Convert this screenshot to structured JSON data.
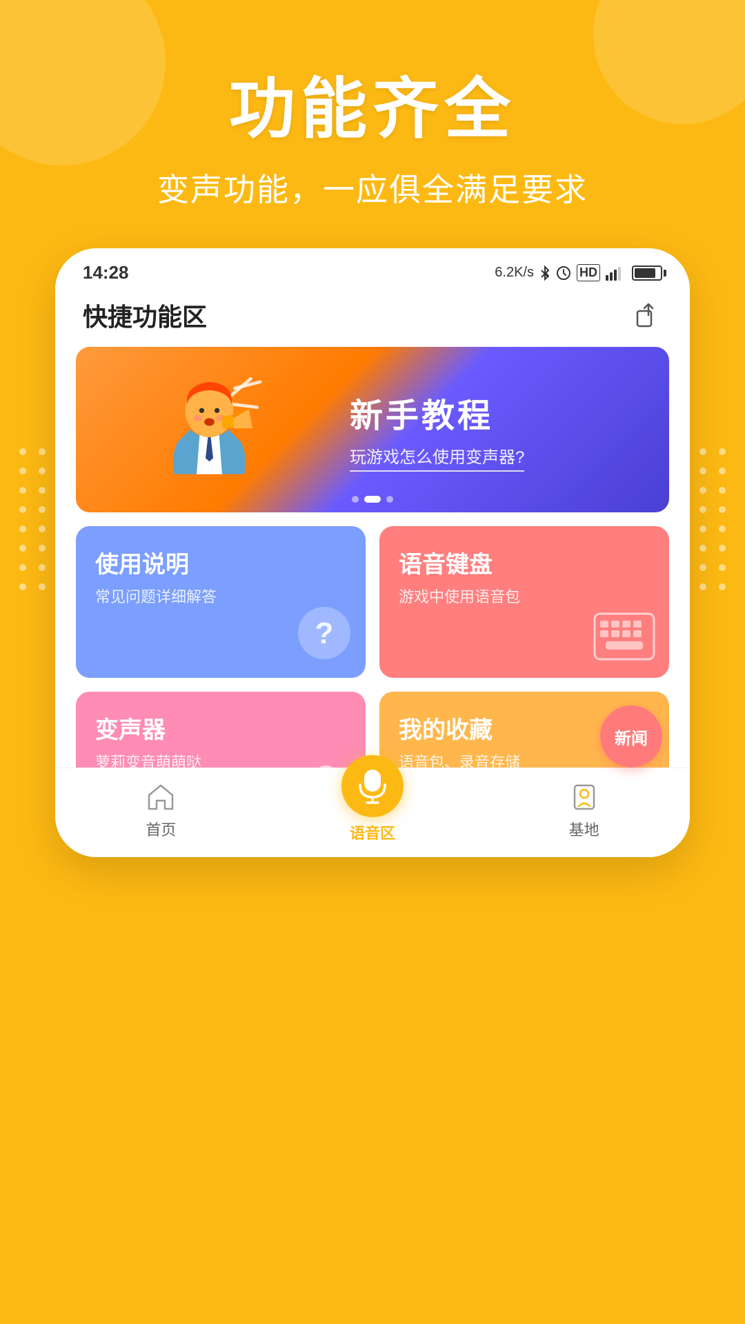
{
  "background_color": "#FDB913",
  "header": {
    "main_title": "功能齐全",
    "sub_title": "变声功能，一应俱全满足要求"
  },
  "status_bar": {
    "time": "14:28",
    "network_speed": "6.2K/s",
    "icons": "bluetooth clock hd signal battery"
  },
  "app_header": {
    "title": "快捷功能区"
  },
  "banner": {
    "title": "新手教程",
    "subtitle": "玩游戏怎么使用变声器?",
    "dots": [
      {
        "active": false
      },
      {
        "active": true
      },
      {
        "active": false
      }
    ]
  },
  "cards": [
    {
      "id": "usage",
      "title": "使用说明",
      "subtitle": "常见问题详细解答",
      "color": "blue",
      "icon": "question"
    },
    {
      "id": "voice-keyboard",
      "title": "语音键盘",
      "subtitle": "游戏中使用语音包",
      "color": "red",
      "icon": "keyboard"
    },
    {
      "id": "voice-changer",
      "title": "变声器",
      "subtitle": "萝莉变音萌萌哒",
      "color": "pink",
      "icon": "microphone"
    },
    {
      "id": "favorites",
      "title": "我的收藏",
      "subtitle": "语音包、录音存储",
      "color": "orange",
      "icon": "box"
    }
  ],
  "floating_button": {
    "label": "新闻"
  },
  "bottom_nav": [
    {
      "id": "home",
      "label": "首页",
      "active": false,
      "icon": "home"
    },
    {
      "id": "voice-zone",
      "label": "语音区",
      "active": true,
      "icon": "microphone"
    },
    {
      "id": "base",
      "label": "基地",
      "active": false,
      "icon": "base"
    }
  ]
}
